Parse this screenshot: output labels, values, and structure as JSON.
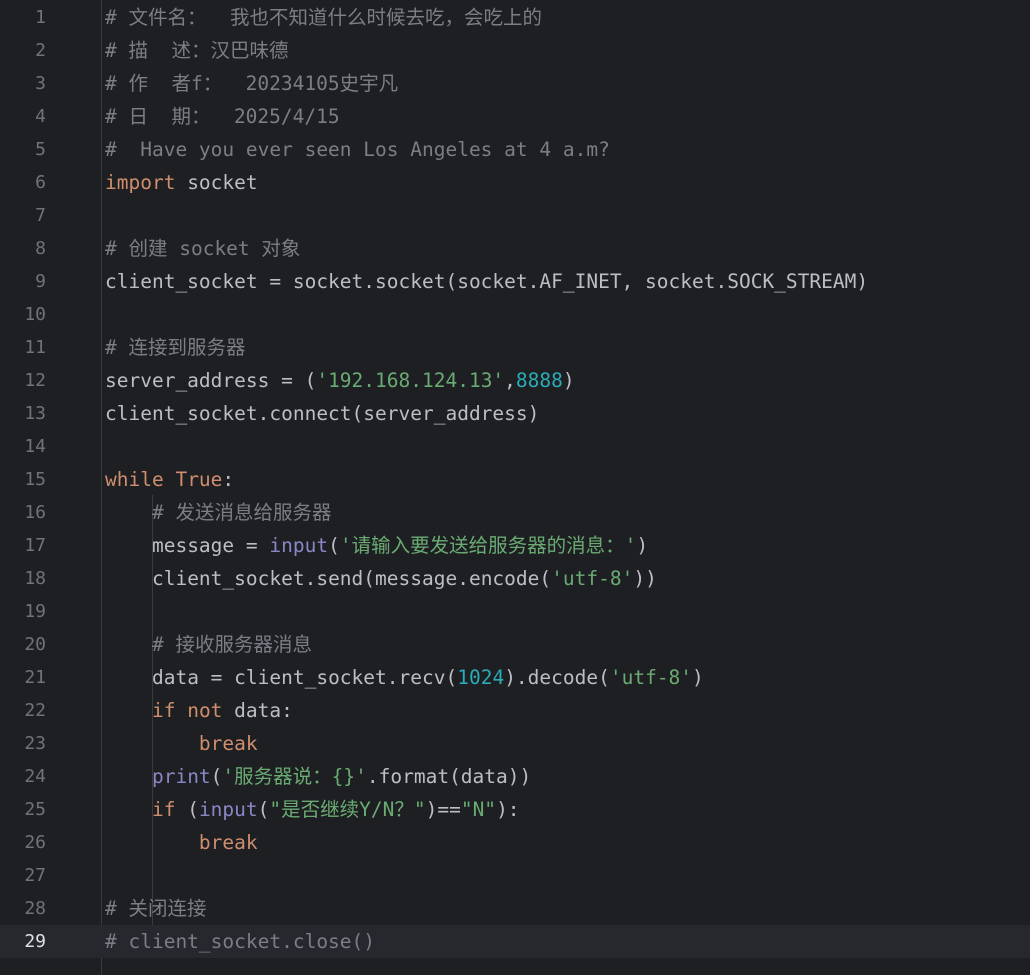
{
  "editor": {
    "current_line": 29,
    "colors": {
      "background": "#1e1f22",
      "current_line": "#26282e",
      "keyword": "#cf8e6d",
      "comment": "#7a7e85",
      "string": "#6aab73",
      "number": "#2aacb8",
      "builtin": "#8888c6",
      "plain": "#bcbec4",
      "line_number": "#6f737a"
    },
    "lines": [
      {
        "n": "1",
        "indent": "",
        "tokens": [
          {
            "t": "# 文件名：  我也不知道什么时候去吃，会吃上的",
            "k": "comment"
          }
        ]
      },
      {
        "n": "2",
        "indent": "",
        "tokens": [
          {
            "t": "# 描  述：汉巴味德",
            "k": "comment"
          }
        ]
      },
      {
        "n": "3",
        "indent": "",
        "tokens": [
          {
            "t": "# 作  者f：  20234105史宇凡",
            "k": "comment"
          }
        ]
      },
      {
        "n": "4",
        "indent": "",
        "tokens": [
          {
            "t": "# 日  期：  2025/4/15",
            "k": "comment"
          }
        ]
      },
      {
        "n": "5",
        "indent": "",
        "tokens": [
          {
            "t": "#  Have you ever seen Los Angeles at 4 a.m?",
            "k": "comment"
          }
        ]
      },
      {
        "n": "6",
        "indent": "",
        "tokens": [
          {
            "t": "import",
            "k": "keyword"
          },
          {
            "t": " socket",
            "k": "plain"
          }
        ]
      },
      {
        "n": "7",
        "indent": "",
        "tokens": []
      },
      {
        "n": "8",
        "indent": "",
        "tokens": [
          {
            "t": "# 创建 socket 对象",
            "k": "comment"
          }
        ]
      },
      {
        "n": "9",
        "indent": "",
        "tokens": [
          {
            "t": "client_socket = socket.socket(socket.AF_INET, socket.SOCK_STREAM)",
            "k": "plain"
          }
        ]
      },
      {
        "n": "10",
        "indent": "",
        "tokens": []
      },
      {
        "n": "11",
        "indent": "",
        "tokens": [
          {
            "t": "# 连接到服务器",
            "k": "comment"
          }
        ]
      },
      {
        "n": "12",
        "indent": "",
        "tokens": [
          {
            "t": "server_address = (",
            "k": "plain"
          },
          {
            "t": "'192.168.124.13'",
            "k": "string"
          },
          {
            "t": ",",
            "k": "plain"
          },
          {
            "t": "8888",
            "k": "number"
          },
          {
            "t": ")",
            "k": "plain"
          }
        ]
      },
      {
        "n": "13",
        "indent": "",
        "tokens": [
          {
            "t": "client_socket.connect(server_address)",
            "k": "plain"
          }
        ]
      },
      {
        "n": "14",
        "indent": "",
        "tokens": []
      },
      {
        "n": "15",
        "indent": "",
        "tokens": [
          {
            "t": "while",
            "k": "keyword"
          },
          {
            "t": " ",
            "k": "plain"
          },
          {
            "t": "True",
            "k": "keyword"
          },
          {
            "t": ":",
            "k": "plain"
          }
        ]
      },
      {
        "n": "16",
        "indent": "    ",
        "tokens": [
          {
            "t": "# 发送消息给服务器",
            "k": "comment"
          }
        ]
      },
      {
        "n": "17",
        "indent": "    ",
        "tokens": [
          {
            "t": "message = ",
            "k": "plain"
          },
          {
            "t": "input",
            "k": "builtin"
          },
          {
            "t": "(",
            "k": "plain"
          },
          {
            "t": "'请输入要发送给服务器的消息：'",
            "k": "string"
          },
          {
            "t": ")",
            "k": "plain"
          }
        ]
      },
      {
        "n": "18",
        "indent": "    ",
        "tokens": [
          {
            "t": "client_socket.send(message.encode(",
            "k": "plain"
          },
          {
            "t": "'utf-8'",
            "k": "string"
          },
          {
            "t": "))",
            "k": "plain"
          }
        ]
      },
      {
        "n": "19",
        "indent": "",
        "tokens": []
      },
      {
        "n": "20",
        "indent": "    ",
        "tokens": [
          {
            "t": "# 接收服务器消息",
            "k": "comment"
          }
        ]
      },
      {
        "n": "21",
        "indent": "    ",
        "tokens": [
          {
            "t": "data = client_socket.recv(",
            "k": "plain"
          },
          {
            "t": "1024",
            "k": "number"
          },
          {
            "t": ").decode(",
            "k": "plain"
          },
          {
            "t": "'utf-8'",
            "k": "string"
          },
          {
            "t": ")",
            "k": "plain"
          }
        ]
      },
      {
        "n": "22",
        "indent": "    ",
        "tokens": [
          {
            "t": "if",
            "k": "keyword"
          },
          {
            "t": " ",
            "k": "plain"
          },
          {
            "t": "not",
            "k": "keyword"
          },
          {
            "t": " data:",
            "k": "plain"
          }
        ]
      },
      {
        "n": "23",
        "indent": "        ",
        "tokens": [
          {
            "t": "break",
            "k": "keyword"
          }
        ]
      },
      {
        "n": "24",
        "indent": "    ",
        "tokens": [
          {
            "t": "print",
            "k": "builtin"
          },
          {
            "t": "(",
            "k": "plain"
          },
          {
            "t": "'服务器说：{}'",
            "k": "string"
          },
          {
            "t": ".format(data))",
            "k": "plain"
          }
        ]
      },
      {
        "n": "25",
        "indent": "    ",
        "tokens": [
          {
            "t": "if",
            "k": "keyword"
          },
          {
            "t": " (",
            "k": "plain"
          },
          {
            "t": "input",
            "k": "builtin"
          },
          {
            "t": "(",
            "k": "plain"
          },
          {
            "t": "\"是否继续Y/N？\"",
            "k": "string"
          },
          {
            "t": ")==",
            "k": "plain"
          },
          {
            "t": "\"N\"",
            "k": "string"
          },
          {
            "t": "):",
            "k": "plain"
          }
        ]
      },
      {
        "n": "26",
        "indent": "        ",
        "tokens": [
          {
            "t": "break",
            "k": "keyword"
          }
        ]
      },
      {
        "n": "27",
        "indent": "",
        "tokens": []
      },
      {
        "n": "28",
        "indent": "",
        "tokens": [
          {
            "t": "# 关闭连接",
            "k": "comment"
          }
        ]
      },
      {
        "n": "29",
        "indent": "",
        "tokens": [
          {
            "t": "# client_socket.close()",
            "k": "comment"
          }
        ]
      }
    ]
  }
}
